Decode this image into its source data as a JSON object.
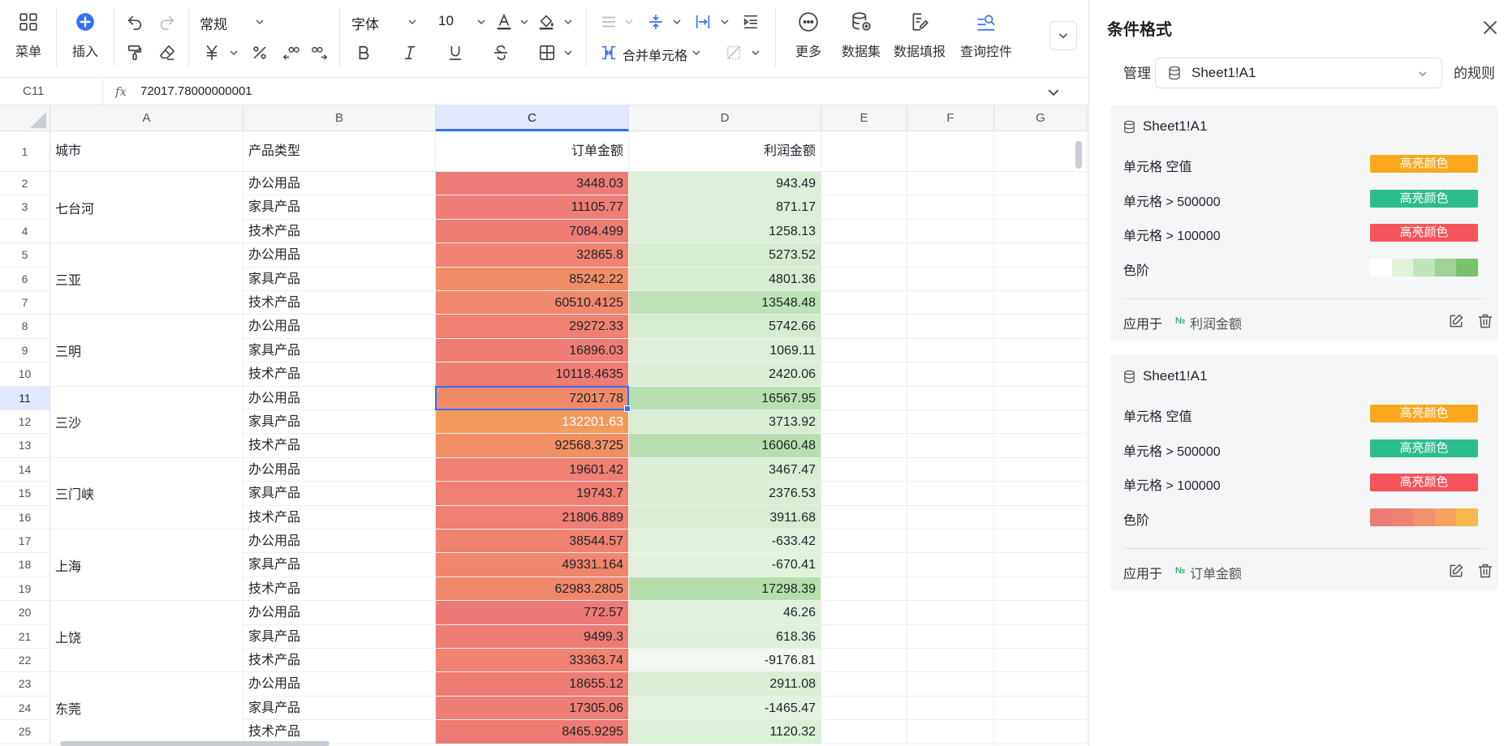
{
  "toolbar": {
    "menu_label": "菜单",
    "insert_label": "插入",
    "number_format": "常规",
    "font_family": "字体",
    "font_size": "10",
    "merge_label": "合并单元格",
    "more_label": "更多",
    "dataset_label": "数据集",
    "data_fill_label": "数据填报",
    "query_control_label": "查询控件",
    "icons": {
      "menu": "grid-icon",
      "insert": "plus-circle-icon",
      "undo": "undo-icon",
      "redo": "redo-icon",
      "format_painter": "paint-roller-icon",
      "clear": "eraser-icon",
      "currency": "yen-icon",
      "percent": "percent-icon",
      "decrease_decimal": "decrease-decimal-icon",
      "increase_decimal": "increase-decimal-icon",
      "bold": "bold-icon",
      "italic": "italic-icon",
      "underline": "underline-icon",
      "strikethrough": "strikethrough-icon",
      "borders": "border-icon",
      "font_color": "font-color-icon",
      "fill_color": "fill-color-icon",
      "more": "ellipsis-icon"
    }
  },
  "formula_bar": {
    "address": "C11",
    "fx": "fx",
    "value": "72017.78000000001"
  },
  "columns": [
    "A",
    "B",
    "C",
    "D",
    "E",
    "F",
    "G"
  ],
  "header_row": {
    "a": "城市",
    "b": "产品类型",
    "c": "订单金额",
    "d": "利润金额"
  },
  "cities": [
    {
      "name": "七台河",
      "start": 2,
      "end": 4
    },
    {
      "name": "三亚",
      "start": 5,
      "end": 7
    },
    {
      "name": "三明",
      "start": 8,
      "end": 10
    },
    {
      "name": "三沙",
      "start": 11,
      "end": 13
    },
    {
      "name": "三门峡",
      "start": 14,
      "end": 16
    },
    {
      "name": "上海",
      "start": 17,
      "end": 19
    },
    {
      "name": "上饶",
      "start": 20,
      "end": 22
    },
    {
      "name": "东莞",
      "start": 23,
      "end": 25
    }
  ],
  "rows": [
    {
      "row": 2,
      "type": "办公用品",
      "order": "3448.03",
      "profit": "943.49",
      "order_color": "#ed7b76",
      "profit_color": "#dcefd8"
    },
    {
      "row": 3,
      "type": "家具产品",
      "order": "11105.77",
      "profit": "871.17",
      "order_color": "#ee7d74",
      "profit_color": "#dcefd8"
    },
    {
      "row": 4,
      "type": "技术产品",
      "order": "7084.499",
      "profit": "1258.13",
      "order_color": "#ed7c75",
      "profit_color": "#dcefd8"
    },
    {
      "row": 5,
      "type": "办公用品",
      "order": "32865.8",
      "profit": "5273.52",
      "order_color": "#ef8270",
      "profit_color": "#d6ecd1"
    },
    {
      "row": 6,
      "type": "家具产品",
      "order": "85242.22",
      "profit": "4801.36",
      "order_color": "#f18e67",
      "profit_color": "#d7edd2"
    },
    {
      "row": 7,
      "type": "技术产品",
      "order": "60510.4125",
      "profit": "13548.48",
      "order_color": "#f0886b",
      "profit_color": "#bfe2b8"
    },
    {
      "row": 8,
      "type": "办公用品",
      "order": "29272.33",
      "profit": "5742.66",
      "order_color": "#ef8171",
      "profit_color": "#d5ecd0"
    },
    {
      "row": 9,
      "type": "家具产品",
      "order": "16896.03",
      "profit": "1069.11",
      "order_color": "#ee7e73",
      "profit_color": "#dcefd8"
    },
    {
      "row": 10,
      "type": "技术产品",
      "order": "10118.4635",
      "profit": "2420.06",
      "order_color": "#ee7d74",
      "profit_color": "#daeed6"
    },
    {
      "row": 11,
      "type": "办公用品",
      "order": "72017.78",
      "profit": "16567.95",
      "order_color": "#f08b69",
      "profit_color": "#b7dfaf"
    },
    {
      "row": 12,
      "type": "家具产品",
      "order": "132201.63",
      "profit": "3713.92",
      "order_color": "#f39a5d",
      "profit_color": "#d8edd4",
      "order_white": true
    },
    {
      "row": 13,
      "type": "技术产品",
      "order": "92568.3725",
      "profit": "16060.48",
      "order_color": "#f19065",
      "profit_color": "#b8dfb0"
    },
    {
      "row": 14,
      "type": "办公用品",
      "order": "19601.42",
      "profit": "3467.47",
      "order_color": "#ee7f72",
      "profit_color": "#d9eed5"
    },
    {
      "row": 15,
      "type": "家具产品",
      "order": "19743.7",
      "profit": "2376.53",
      "order_color": "#ee7f72",
      "profit_color": "#daeed6"
    },
    {
      "row": 16,
      "type": "技术产品",
      "order": "21806.889",
      "profit": "3911.68",
      "order_color": "#ee7f72",
      "profit_color": "#d8edd4"
    },
    {
      "row": 17,
      "type": "办公用品",
      "order": "38544.57",
      "profit": "-633.42",
      "order_color": "#ef8370",
      "profit_color": "#e0f1dc"
    },
    {
      "row": 18,
      "type": "家具产品",
      "order": "49331.164",
      "profit": "-670.41",
      "order_color": "#f0866d",
      "profit_color": "#e0f1dc"
    },
    {
      "row": 19,
      "type": "技术产品",
      "order": "62983.2805",
      "profit": "17298.39",
      "order_color": "#f0896b",
      "profit_color": "#b5deac"
    },
    {
      "row": 20,
      "type": "办公用品",
      "order": "772.57",
      "profit": "46.26",
      "order_color": "#ed7a76",
      "profit_color": "#dff0db"
    },
    {
      "row": 21,
      "type": "家具产品",
      "order": "9499.3",
      "profit": "618.36",
      "order_color": "#ed7c75",
      "profit_color": "#ddf0d9"
    },
    {
      "row": 22,
      "type": "技术产品",
      "order": "33363.74",
      "profit": "-9176.81",
      "order_color": "#ef8270",
      "profit_color": "#f2f9f0"
    },
    {
      "row": 23,
      "type": "办公用品",
      "order": "18655.12",
      "profit": "2911.08",
      "order_color": "#ee7e73",
      "profit_color": "#d9eed5"
    },
    {
      "row": 24,
      "type": "家具产品",
      "order": "17305.06",
      "profit": "-1465.47",
      "order_color": "#ee7e73",
      "profit_color": "#e2f2df"
    },
    {
      "row": 25,
      "type": "技术产品",
      "order": "8465.9295",
      "profit": "1120.32",
      "order_color": "#ed7c75",
      "profit_color": "#dcefd8"
    }
  ],
  "selection": {
    "row": 11,
    "col": "C"
  },
  "panel": {
    "title": "条件格式",
    "manage_label": "管理",
    "manage_value": "Sheet1!A1",
    "rules_label": "的规则",
    "cards": [
      {
        "title": "Sheet1!A1",
        "rules": [
          {
            "label": "单元格 空值",
            "badge": "高亮颜色",
            "color": "#fca71e"
          },
          {
            "label": "单元格 > 500000",
            "badge": "高亮颜色",
            "color": "#2cbd8e"
          },
          {
            "label": "单元格 > 100000",
            "badge": "高亮颜色",
            "color": "#f5545a"
          }
        ],
        "scale_label": "色阶",
        "scale_colors": [
          "#ffffff",
          "#e0f1dc",
          "#c1e3ba",
          "#9fd396",
          "#78c26c"
        ],
        "apply_label": "应用于",
        "apply_tag": "№",
        "apply_value": "利润金额"
      },
      {
        "title": "Sheet1!A1",
        "rules": [
          {
            "label": "单元格 空值",
            "badge": "高亮颜色",
            "color": "#fca71e"
          },
          {
            "label": "单元格 > 500000",
            "badge": "高亮颜色",
            "color": "#2cbd8e"
          },
          {
            "label": "单元格 > 100000",
            "badge": "高亮颜色",
            "color": "#f5545a"
          }
        ],
        "scale_label": "色阶",
        "scale_colors": [
          "#ed7b76",
          "#ef8371",
          "#f2926a",
          "#f5a35f",
          "#f8b74e"
        ],
        "apply_label": "应用于",
        "apply_tag": "№",
        "apply_value": "订单金额"
      }
    ]
  }
}
